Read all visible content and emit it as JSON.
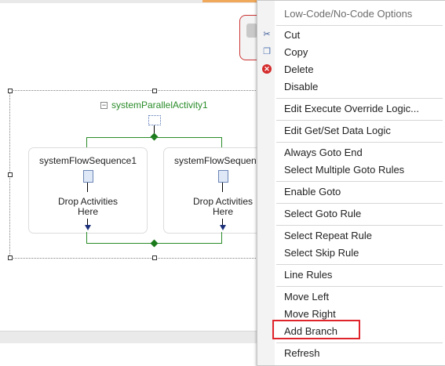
{
  "designer": {
    "parallel_activity_title": "systemParallelActivity1",
    "sequences": [
      {
        "title": "systemFlowSequence1",
        "drop_text_line1": "Drop Activities",
        "drop_text_line2": "Here"
      },
      {
        "title": "systemFlowSequence",
        "drop_text_line1": "Drop Activities",
        "drop_text_line2": "Here"
      }
    ]
  },
  "context_menu": {
    "header": "Low-Code/No-Code Options",
    "items": [
      {
        "label": "Cut",
        "icon": "scissors-icon"
      },
      {
        "label": "Copy",
        "icon": "copy-icon"
      },
      {
        "label": "Delete",
        "icon": "delete-icon"
      },
      {
        "label": "Disable"
      },
      {
        "label": "Edit Execute Override Logic..."
      },
      {
        "label": "Edit Get/Set Data Logic"
      },
      {
        "label": "Always Goto End"
      },
      {
        "label": "Select Multiple Goto Rules"
      },
      {
        "label": "Enable Goto"
      },
      {
        "label": "Select Goto Rule"
      },
      {
        "label": "Select Repeat Rule"
      },
      {
        "label": "Select Skip Rule"
      },
      {
        "label": "Line Rules"
      },
      {
        "label": "Move Left"
      },
      {
        "label": "Move Right"
      },
      {
        "label": "Add Branch"
      },
      {
        "label": "Refresh"
      }
    ]
  },
  "colors": {
    "accent_green": "#2a8c2a",
    "highlight_red": "#e0242b",
    "delete_red": "#d52b2b"
  }
}
